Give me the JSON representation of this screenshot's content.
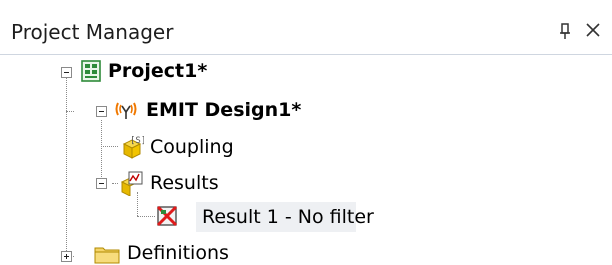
{
  "panel": {
    "title": "Project Manager",
    "pin_icon": "pin-icon",
    "close_icon": "close-icon"
  },
  "tree": {
    "project": {
      "label": "Project1*",
      "icon": "project-icon",
      "expanded": true
    },
    "design": {
      "label": "EMIT Design1*",
      "icon": "emit-design-icon",
      "expanded": true
    },
    "coupling": {
      "label": "Coupling",
      "icon": "coupling-icon"
    },
    "results": {
      "label": "Results",
      "icon": "results-icon",
      "expanded": true
    },
    "result1": {
      "label": "Result 1 - No filter",
      "icon": "result-error-icon",
      "selected": true
    },
    "definitions": {
      "label": "Definitions",
      "icon": "folder-icon",
      "expanded": false
    }
  },
  "colors": {
    "border": "#cfd6e0",
    "tree_lines": "#8a8a8a",
    "selection": "#eef0f3",
    "project_icon": "#2e8b3a",
    "result_x": "#e01b1b"
  }
}
